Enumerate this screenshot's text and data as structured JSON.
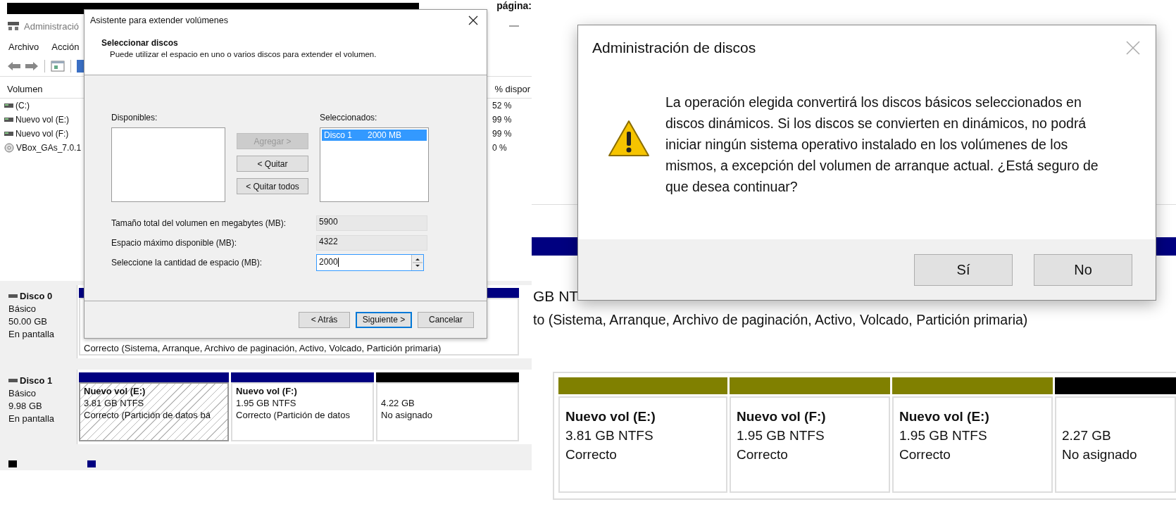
{
  "left_capture": {
    "window_title": "Administració",
    "corner_text": "página:",
    "menu": [
      "Archivo",
      "Acción"
    ],
    "volume_columns": [
      "Volumen",
      "% dispor"
    ],
    "volumes": [
      {
        "name": "(C:)",
        "kind": "disk",
        "free": "52 %"
      },
      {
        "name": "Nuevo vol (E:)",
        "kind": "disk",
        "free": "99 %"
      },
      {
        "name": "Nuevo vol (F:)",
        "kind": "disk",
        "free": "99 %"
      },
      {
        "name": "VBox_GAs_7.0.1",
        "kind": "cd",
        "free": "0 %"
      }
    ],
    "disks": [
      {
        "name": "Disco 0",
        "type": "Básico",
        "size": "50.00 GB",
        "status": "En pantalla",
        "partitions": [
          {
            "status": "Correcto (Sistema, Arranque, Archivo de paginación, Activo, Volcado, Partición primaria)",
            "color": "#000080",
            "selected": false
          }
        ]
      },
      {
        "name": "Disco 1",
        "type": "Básico",
        "size": "9.98 GB",
        "status": "En pantalla",
        "partitions": [
          {
            "name": "Nuevo vol  (E:)",
            "size": "3.81 GB NTFS",
            "status": "Correcto (Partición de datos bá",
            "color": "#000080",
            "selected": true
          },
          {
            "name": "Nuevo vol  (F:)",
            "size": "1.95 GB NTFS",
            "status": "Correcto (Partición de datos",
            "color": "#000080",
            "selected": false
          },
          {
            "size": "4.22 GB",
            "status": "No asignado",
            "color": "#000000",
            "selected": false
          }
        ]
      }
    ],
    "legend": [
      {
        "color": "#000000"
      },
      {
        "color": "#000080"
      }
    ],
    "wizard": {
      "title": "Asistente para extender volúmenes",
      "heading": "Seleccionar discos",
      "subheading": "Puede utilizar el espacio en uno o varios discos para extender el volumen.",
      "available_label": "Disponibles:",
      "selected_label": "Seleccionados:",
      "selected_items": [
        {
          "disk": "Disco 1",
          "size": "2000 MB",
          "selected": true
        }
      ],
      "move_buttons": [
        {
          "label": "Agregar >",
          "disabled": true
        },
        {
          "label": "< Quitar",
          "disabled": false
        },
        {
          "label": "< Quitar todos",
          "disabled": false
        }
      ],
      "fields": [
        {
          "label": "Tamaño total del volumen en megabytes (MB):",
          "value": "5900",
          "kind": "readonly"
        },
        {
          "label": "Espacio máximo disponible (MB):",
          "value": "4322",
          "kind": "readonly"
        },
        {
          "label": "Seleccione la cantidad de espacio (MB):",
          "value": "2000",
          "kind": "spinner"
        }
      ],
      "buttons": [
        {
          "label": "< Atrás",
          "default": false
        },
        {
          "label": "Siguiente >",
          "default": true
        },
        {
          "label": "Cancelar",
          "default": false
        }
      ]
    }
  },
  "right_capture": {
    "background_texts": [
      "GB NT",
      "to (Sistema, Arranque, Archivo de paginación, Activo, Volcado, Partición primaria)"
    ],
    "partitions": [
      {
        "name": "Nuevo vol  (E:)",
        "size": "3.81 GB NTFS",
        "status": "Correcto",
        "color": "#808000"
      },
      {
        "name": "Nuevo vol  (F:)",
        "size": "1.95 GB NTFS",
        "status": "Correcto",
        "color": "#808000"
      },
      {
        "name": "Nuevo vol  (E:)",
        "size": "1.95 GB NTFS",
        "status": "Correcto",
        "color": "#808000"
      },
      {
        "size": "2.27 GB",
        "status": "No asignado",
        "color": "#000000"
      }
    ],
    "dialog": {
      "title": "Administración de discos",
      "message": "La operación elegida convertirá los discos básicos seleccionados en discos dinámicos. Si los discos se convierten en dinámicos, no podrá iniciar ningún sistema operativo instalado en los volúmenes de los mismos, a excepción del volumen de arranque actual. ¿Está seguro de que desea continuar?",
      "buttons": [
        "Sí",
        "No"
      ]
    }
  }
}
